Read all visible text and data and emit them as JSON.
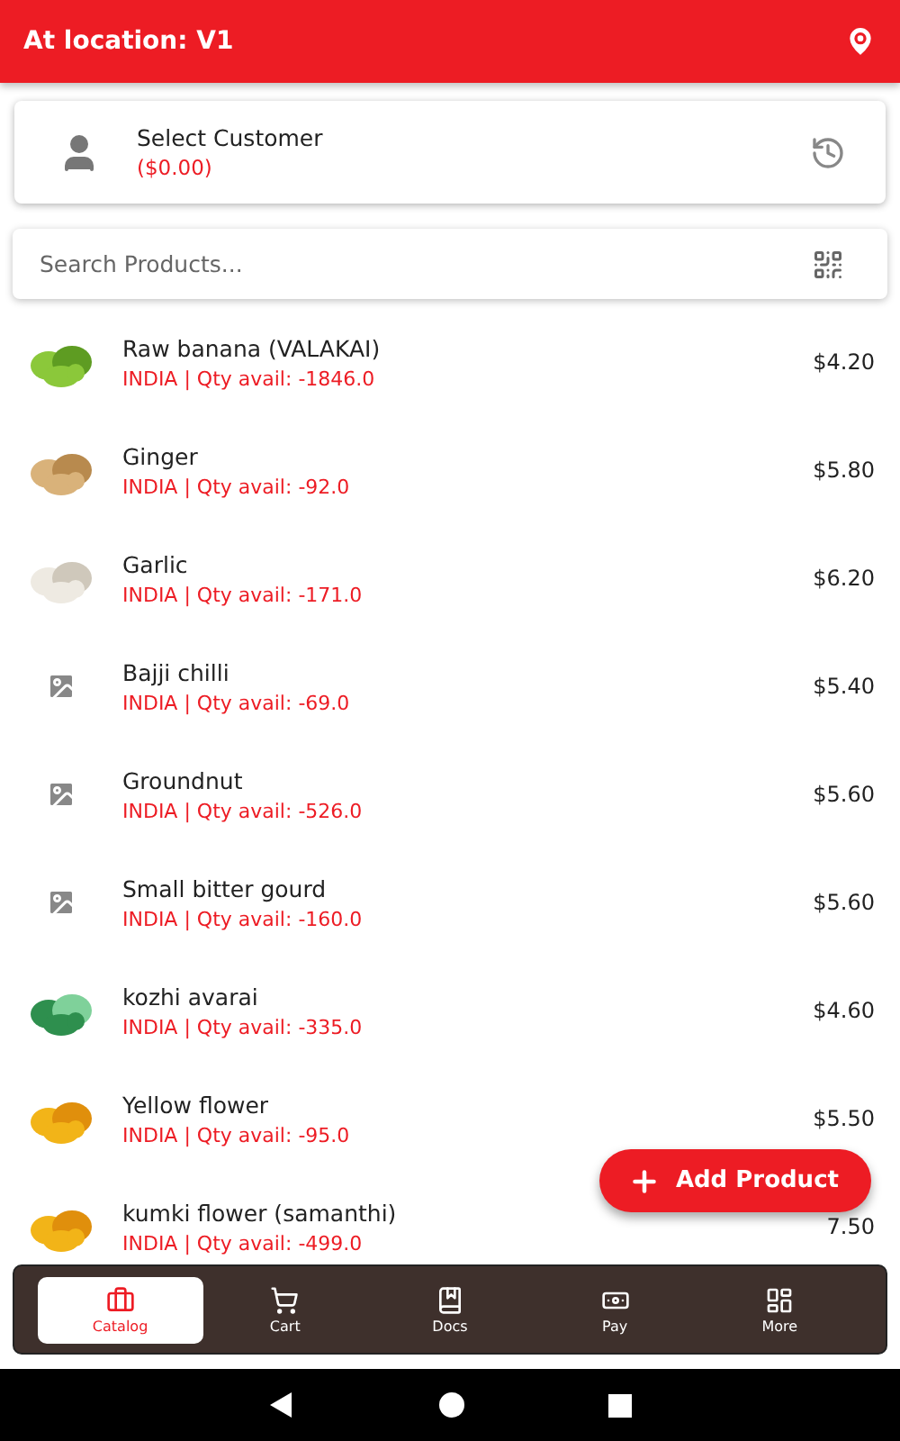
{
  "header": {
    "title": "At location: V1"
  },
  "customer": {
    "name": "Select Customer",
    "balance": "($0.00)"
  },
  "search": {
    "placeholder": "Search Products..."
  },
  "products": [
    {
      "name": "Raw banana (VALAKAI)",
      "detail": "INDIA | Qty avail: -1846.0",
      "price": "$4.20"
    },
    {
      "name": "Ginger",
      "detail": "INDIA | Qty avail: -92.0",
      "price": "$5.80"
    },
    {
      "name": "Garlic",
      "detail": "INDIA | Qty avail: -171.0",
      "price": "$6.20"
    },
    {
      "name": "Bajji chilli",
      "detail": "INDIA | Qty avail: -69.0",
      "price": "$5.40",
      "kind": "placeholder"
    },
    {
      "name": "Groundnut",
      "detail": "INDIA | Qty avail: -526.0",
      "price": "$5.60",
      "kind": "placeholder"
    },
    {
      "name": "Small bitter gourd",
      "detail": "INDIA | Qty avail: -160.0",
      "price": "$5.60",
      "kind": "placeholder"
    },
    {
      "name": "kozhi avarai",
      "detail": "INDIA | Qty avail: -335.0",
      "price": "$4.60"
    },
    {
      "name": "Yellow flower",
      "detail": "INDIA | Qty avail: -95.0",
      "price": "$5.50"
    },
    {
      "name": "kumki flower (samanthi)",
      "detail": "INDIA | Qty avail: -499.0",
      "price": "7.50"
    }
  ],
  "fab": {
    "label": "Add Product"
  },
  "nav": [
    {
      "label": "Catalog",
      "selected": true
    },
    {
      "label": "Cart",
      "selected": false
    },
    {
      "label": "Docs",
      "selected": false
    },
    {
      "label": "Pay",
      "selected": false
    },
    {
      "label": "More",
      "selected": false
    }
  ]
}
